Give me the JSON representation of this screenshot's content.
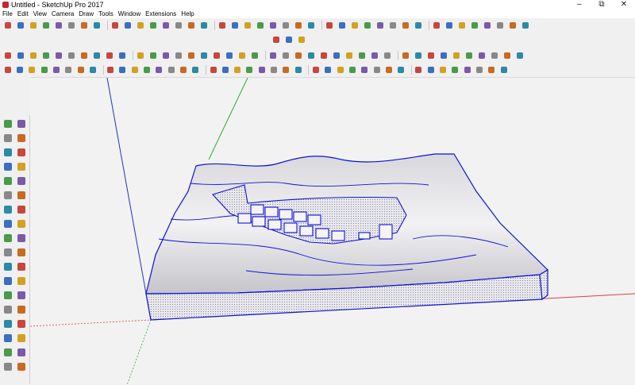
{
  "window": {
    "title": "Untitled - SketchUp Pro 2017",
    "minimize": "–",
    "maximize": "⧉",
    "close": "✕"
  },
  "menu": [
    "File",
    "Edit",
    "View",
    "Camera",
    "Draw",
    "Tools",
    "Window",
    "Extensions",
    "Help"
  ],
  "colors": {
    "axis_red": "#d84040",
    "axis_green": "#33aa33",
    "axis_blue": "#2030c8",
    "edge": "#1010d8"
  },
  "toolbars": {
    "row1_icons": [
      "select-icon",
      "lasso-icon",
      "paint-icon",
      "eraser-icon",
      "tape-icon",
      "protractor-icon",
      "axes-icon",
      "dimension-icon",
      "text-icon",
      "3dtext-icon",
      "section-plane-icon",
      "walk-icon",
      "position-camera-icon",
      "look-around-icon",
      "add-location-icon",
      "toggle-terrain-icon",
      "photo-textures-icon",
      "get-models-icon",
      "share-model-icon",
      "extension-warehouse-icon",
      "layout-icon",
      "sandbox-smoove-icon",
      "stamp-icon",
      "drape-icon",
      "add-detail-icon",
      "flip-edge-icon",
      "from-contours-icon",
      "from-scratch-icon",
      "solid-union-icon",
      "solid-subtract-icon",
      "solid-trim-icon",
      "solid-split-icon",
      "outer-shell-icon",
      "intersect-icon",
      "style-builder-icon",
      "scenes-icon",
      "shadows-icon",
      "fog-icon",
      "match-photo-icon",
      "soften-icon"
    ],
    "row2_icons": [
      "warehouse-icon",
      "components-icon",
      "extension-manager-icon"
    ],
    "row3_icons": [
      "pencil-icon",
      "ellipse-icon",
      "circle-icon",
      "polygon-icon",
      "arc-icon",
      "arc2-icon",
      "pie-icon",
      "freehand-icon",
      "rotated-rect-icon",
      "offset-icon",
      "follow-me-icon",
      "scale-icon",
      "push-pull-icon",
      "move-icon",
      "rotate-icon",
      "iso-view-icon",
      "top-view-icon",
      "front-view-icon",
      "right-view-icon",
      "back-view-icon",
      "left-view-icon",
      "camera-icon",
      "zoom-icon",
      "zoom-window-icon",
      "zoom-extents-icon",
      "previous-view-icon",
      "next-view-icon",
      "xray-icon",
      "back-edges-icon",
      "wireframe-icon",
      "hidden-line-icon",
      "shaded-icon",
      "shaded-textures-icon",
      "monochrome-icon",
      "section-fill-icon",
      "section-cuts-icon",
      "section-planes-icon",
      "layer-icon",
      "outliner-icon",
      "entity-info-icon"
    ],
    "row4_icons": [
      "line-icon",
      "rectangle-icon",
      "circle2-icon",
      "arc3-icon",
      "push-pull2-icon",
      "follow-me2-icon",
      "offset2-icon",
      "move2-icon",
      "rotate2-icon",
      "scale2-icon",
      "tape2-icon",
      "dimension2-icon",
      "protractor2-icon",
      "text2-icon",
      "axes2-icon",
      "3dtext2-icon",
      "orbit-icon",
      "pan-icon",
      "zoom2-icon",
      "zoom-extents2-icon",
      "section-plane2-icon",
      "walk2-icon",
      "look-around2-icon",
      "position-camera2-icon",
      "component-icon",
      "group-icon",
      "paint2-icon",
      "eraser2-icon",
      "lasso2-icon",
      "intersect2-icon",
      "sandbox2-icon",
      "solid2-icon",
      "scenes2-icon",
      "shadows2-icon",
      "fog2-icon",
      "styles2-icon",
      "layers2-icon",
      "outliner2-icon",
      "entity2-icon",
      "soften2-icon"
    ]
  },
  "left_tools": [
    "select-icon",
    "make-component-icon",
    "paint-bucket-icon",
    "eraser-icon",
    "line-icon",
    "freehand-icon",
    "rectangle-icon",
    "rotated-rectangle-icon",
    "circle-icon",
    "polygon-icon",
    "arc-icon",
    "two-point-arc-icon",
    "three-point-arc-icon",
    "pie-icon",
    "move-icon",
    "push-pull-icon",
    "rotate-icon",
    "follow-me-icon",
    "scale-icon",
    "offset-icon",
    "tape-measure-icon",
    "dimension-icon",
    "protractor-icon",
    "text-icon",
    "axes-icon",
    "3d-text-icon",
    "orbit-icon",
    "pan-icon",
    "zoom-icon",
    "zoom-window-icon",
    "zoom-extents-icon",
    "previous-icon",
    "position-camera-icon",
    "look-around-icon",
    "walk-icon",
    "section-plane-icon"
  ]
}
